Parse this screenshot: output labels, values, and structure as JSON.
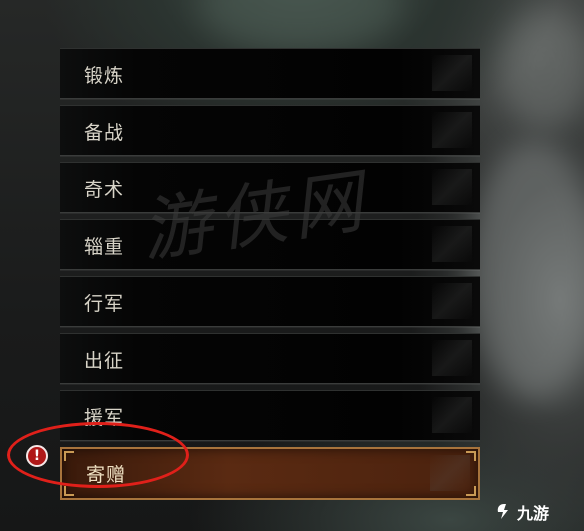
{
  "menu": {
    "items": [
      {
        "label": "锻炼"
      },
      {
        "label": "备战"
      },
      {
        "label": "奇术"
      },
      {
        "label": "辎重"
      },
      {
        "label": "行军"
      },
      {
        "label": "出征"
      },
      {
        "label": "援军"
      },
      {
        "label": "寄赠",
        "selected": true,
        "alert": true
      }
    ]
  },
  "alert_badge": {
    "symbol": "!"
  },
  "watermark": {
    "text": "游侠网"
  },
  "logo": {
    "text": "九游"
  },
  "colors": {
    "alert_red": "#b01818",
    "highlight_ring": "#e0201a",
    "selected_fill": "#5a2a12",
    "selected_border": "#a8743c",
    "item_text": "#d8d4c8"
  }
}
